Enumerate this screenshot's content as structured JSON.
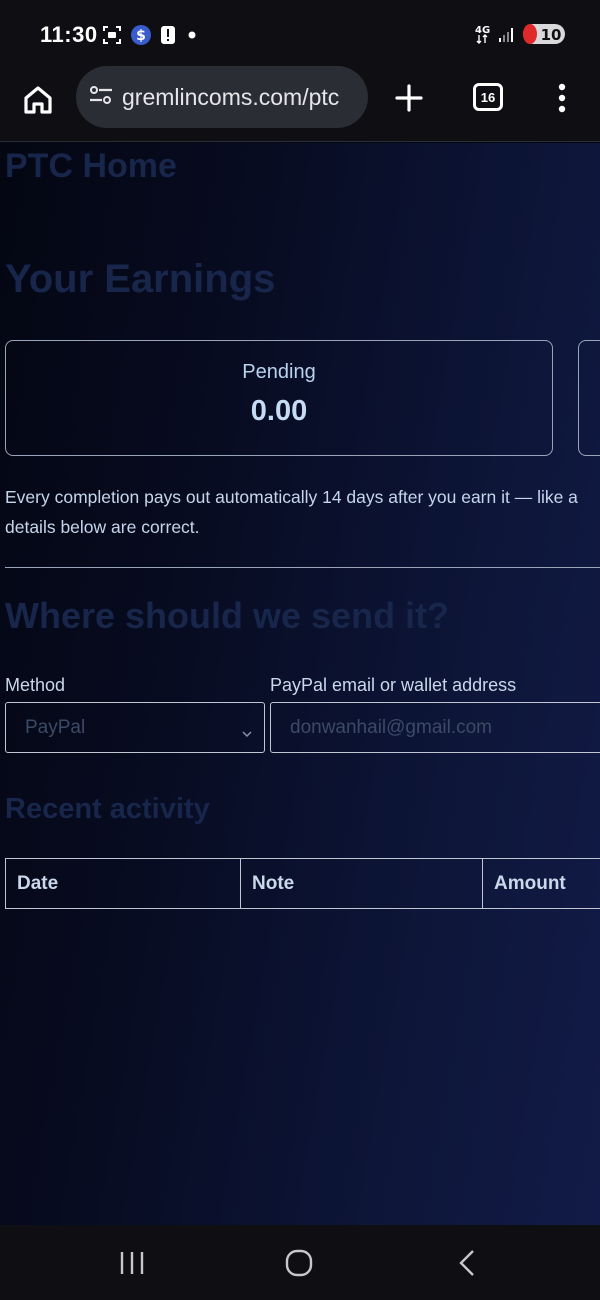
{
  "status_bar": {
    "time": "11:30",
    "network": "4G",
    "battery": "10",
    "icons_left": [
      "screenshot-icon",
      "dollar-app-icon",
      "alert-icon",
      "dot-icon"
    ],
    "icons_right": [
      "network-4g-icon",
      "signal-icon",
      "battery-icon"
    ]
  },
  "browser": {
    "url": "gremlincoms.com/ptc",
    "tab_count": "16"
  },
  "page": {
    "heading": "PTC Home",
    "earnings_title": "Your Earnings",
    "cards": [
      {
        "label": "Pending",
        "value": "0.00"
      }
    ],
    "payout_info": "Every completion pays out automatically 14 days after you earn it — like a",
    "payout_info_2": "details below are correct.",
    "send_title": "Where should we send it?",
    "method_label": "Method",
    "method_selected": "PayPal",
    "address_label": "PayPal email or wallet address",
    "address_placeholder": "donwanhail@gmail.com",
    "activity_title": "Recent activity",
    "table_headers": [
      "Date",
      "Note",
      "Amount"
    ]
  },
  "colors": {
    "heading_dim": "#17264a",
    "text_light": "#c5d6ea",
    "border": "#9aa4b8"
  }
}
